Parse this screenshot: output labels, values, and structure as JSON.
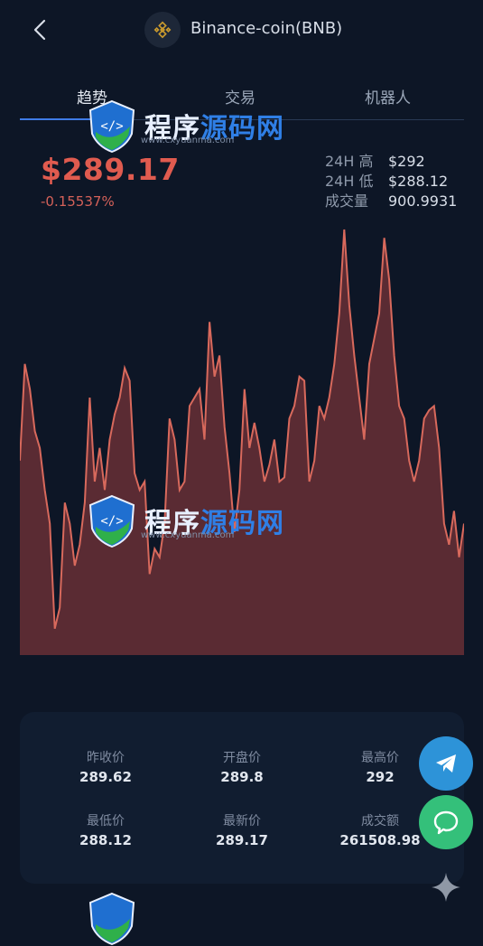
{
  "header": {
    "title": "Binance-coin(BNB)",
    "back_icon": "chevron-left-icon",
    "coin_icon": "bnb-icon"
  },
  "tabs": [
    {
      "label": "趋势",
      "active": true
    },
    {
      "label": "交易",
      "active": false
    },
    {
      "label": "机器人",
      "active": false
    }
  ],
  "price": {
    "current": "$289.17",
    "change": "-0.15537%",
    "color": "#e05b4f"
  },
  "stats": {
    "high_label": "24H 高",
    "high_value": "$292",
    "low_label": "24H 低",
    "low_value": "$288.12",
    "volume_label": "成交量",
    "volume_value": "900.9931"
  },
  "chart_data": {
    "type": "area",
    "title": "",
    "xlabel": "",
    "ylabel": "",
    "grid": false,
    "line_color": "#d8695c",
    "fill_color": "#5a2b33",
    "ylim": [
      0,
      100
    ],
    "values": [
      45,
      68,
      62,
      52,
      48,
      38,
      30,
      5,
      10,
      35,
      30,
      20,
      25,
      35,
      60,
      40,
      48,
      38,
      50,
      56,
      60,
      67,
      64,
      42,
      38,
      40,
      18,
      24,
      22,
      30,
      55,
      50,
      38,
      40,
      58,
      60,
      62,
      50,
      78,
      65,
      70,
      53,
      42,
      28,
      38,
      62,
      48,
      54,
      48,
      40,
      44,
      50,
      40,
      41,
      55,
      58,
      65,
      64,
      40,
      45,
      58,
      55,
      60,
      68,
      80,
      100,
      82,
      70,
      60,
      50,
      68,
      74,
      80,
      98,
      88,
      70,
      58,
      55,
      45,
      40,
      45,
      55,
      57,
      58,
      48,
      30,
      25,
      33,
      22,
      30
    ]
  },
  "summary": [
    {
      "label": "昨收价",
      "value": "289.62"
    },
    {
      "label": "开盘价",
      "value": "289.8"
    },
    {
      "label": "最高价",
      "value": "292"
    },
    {
      "label": "最低价",
      "value": "288.12"
    },
    {
      "label": "最新价",
      "value": "289.17"
    },
    {
      "label": "成交额",
      "value": "261508.98"
    }
  ],
  "fabs": {
    "telegram_icon": "telegram-icon",
    "chat_icon": "chat-bubble-icon",
    "sparkle_icon": "sparkle-icon"
  },
  "watermark": {
    "text_a": "程序",
    "text_b": "源码网",
    "subtext": "www.cxyuanma.com"
  }
}
